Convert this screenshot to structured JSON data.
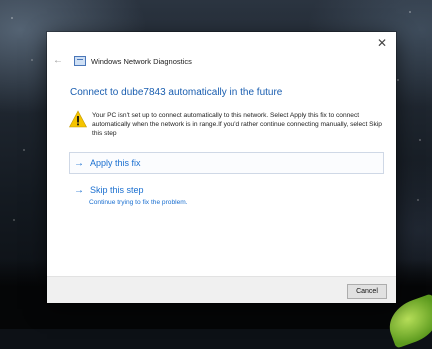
{
  "window": {
    "title": "Windows Network Diagnostics",
    "back_icon": "back-arrow-icon",
    "close_icon": "close-icon"
  },
  "content": {
    "heading": "Connect to dube7843 automatically in the future",
    "warning_icon": "warning-icon",
    "message": "Your PC isn't set up to connect automatically to this network. Select Apply this fix to connect automatically when the network is in range.If you'd rather continue connecting manually, select Skip this step"
  },
  "options": {
    "apply": {
      "label": "Apply this fix"
    },
    "skip": {
      "label": "Skip this step",
      "sublabel": "Continue trying to fix the problem."
    }
  },
  "footer": {
    "cancel_label": "Cancel"
  },
  "colors": {
    "accent": "#1a6fd0",
    "heading": "#1a5eb0",
    "warning": "#f5c400"
  }
}
